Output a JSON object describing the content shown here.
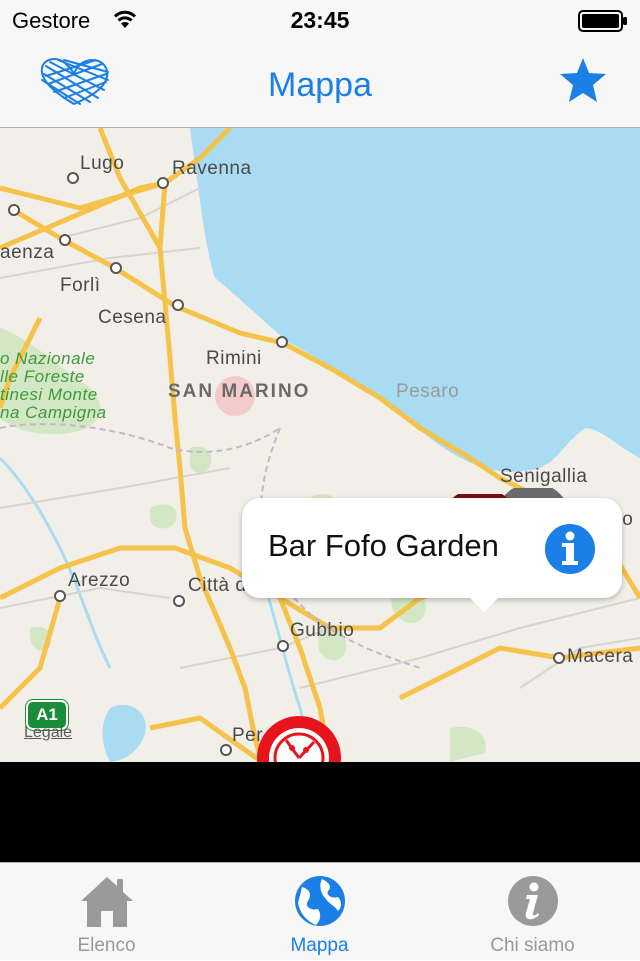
{
  "status_bar": {
    "carrier": "Gestore",
    "time": "23:45"
  },
  "nav": {
    "title": "Mappa",
    "left_icon": "heart-logo-icon",
    "right_icon": "star-icon"
  },
  "map": {
    "places": {
      "lugo": "Lugo",
      "ravenna": "Ravenna",
      "faenza": "aenza",
      "forli": "Forlì",
      "cesena": "Cesena",
      "rimini": "Rimini",
      "san_marino": "SAN MARINO",
      "pesaro": "Pesaro",
      "senigallia": "Senigallia",
      "ancona": "Anco",
      "park_line1": "o Nazionale",
      "park_line2": "lle Foreste",
      "park_line3": "tinesi Monte",
      "park_line4": "na Campigna",
      "arezzo": "Arezzo",
      "citta_di_castello": "Città di Castello",
      "gubbio": "Gubbio",
      "macerata": "Macera",
      "perugia": "Per"
    },
    "highway_shield": "A1",
    "legal": "Legale",
    "callout": {
      "title": "Bar Fofo Garden",
      "info_icon": "info-icon"
    },
    "pins": [
      "coffee-pin-icon",
      "restaurant-pin-icon",
      "cyan-pin-icon",
      "pizza-pin-icon"
    ]
  },
  "tabs": [
    {
      "label": "Elenco",
      "icon": "home-icon",
      "active": false
    },
    {
      "label": "Mappa",
      "icon": "globe-icon",
      "active": true
    },
    {
      "label": "Chi siamo",
      "icon": "info-icon",
      "active": false
    }
  ],
  "colors": {
    "accent": "#1b7fe8",
    "sea": "#a9dcf2",
    "land": "#f2efe8",
    "road": "#f7c34a",
    "coffee_pin": "#7a1010",
    "pizza_pin": "#e8141b",
    "cyan_pin": "#2ae0f0"
  }
}
